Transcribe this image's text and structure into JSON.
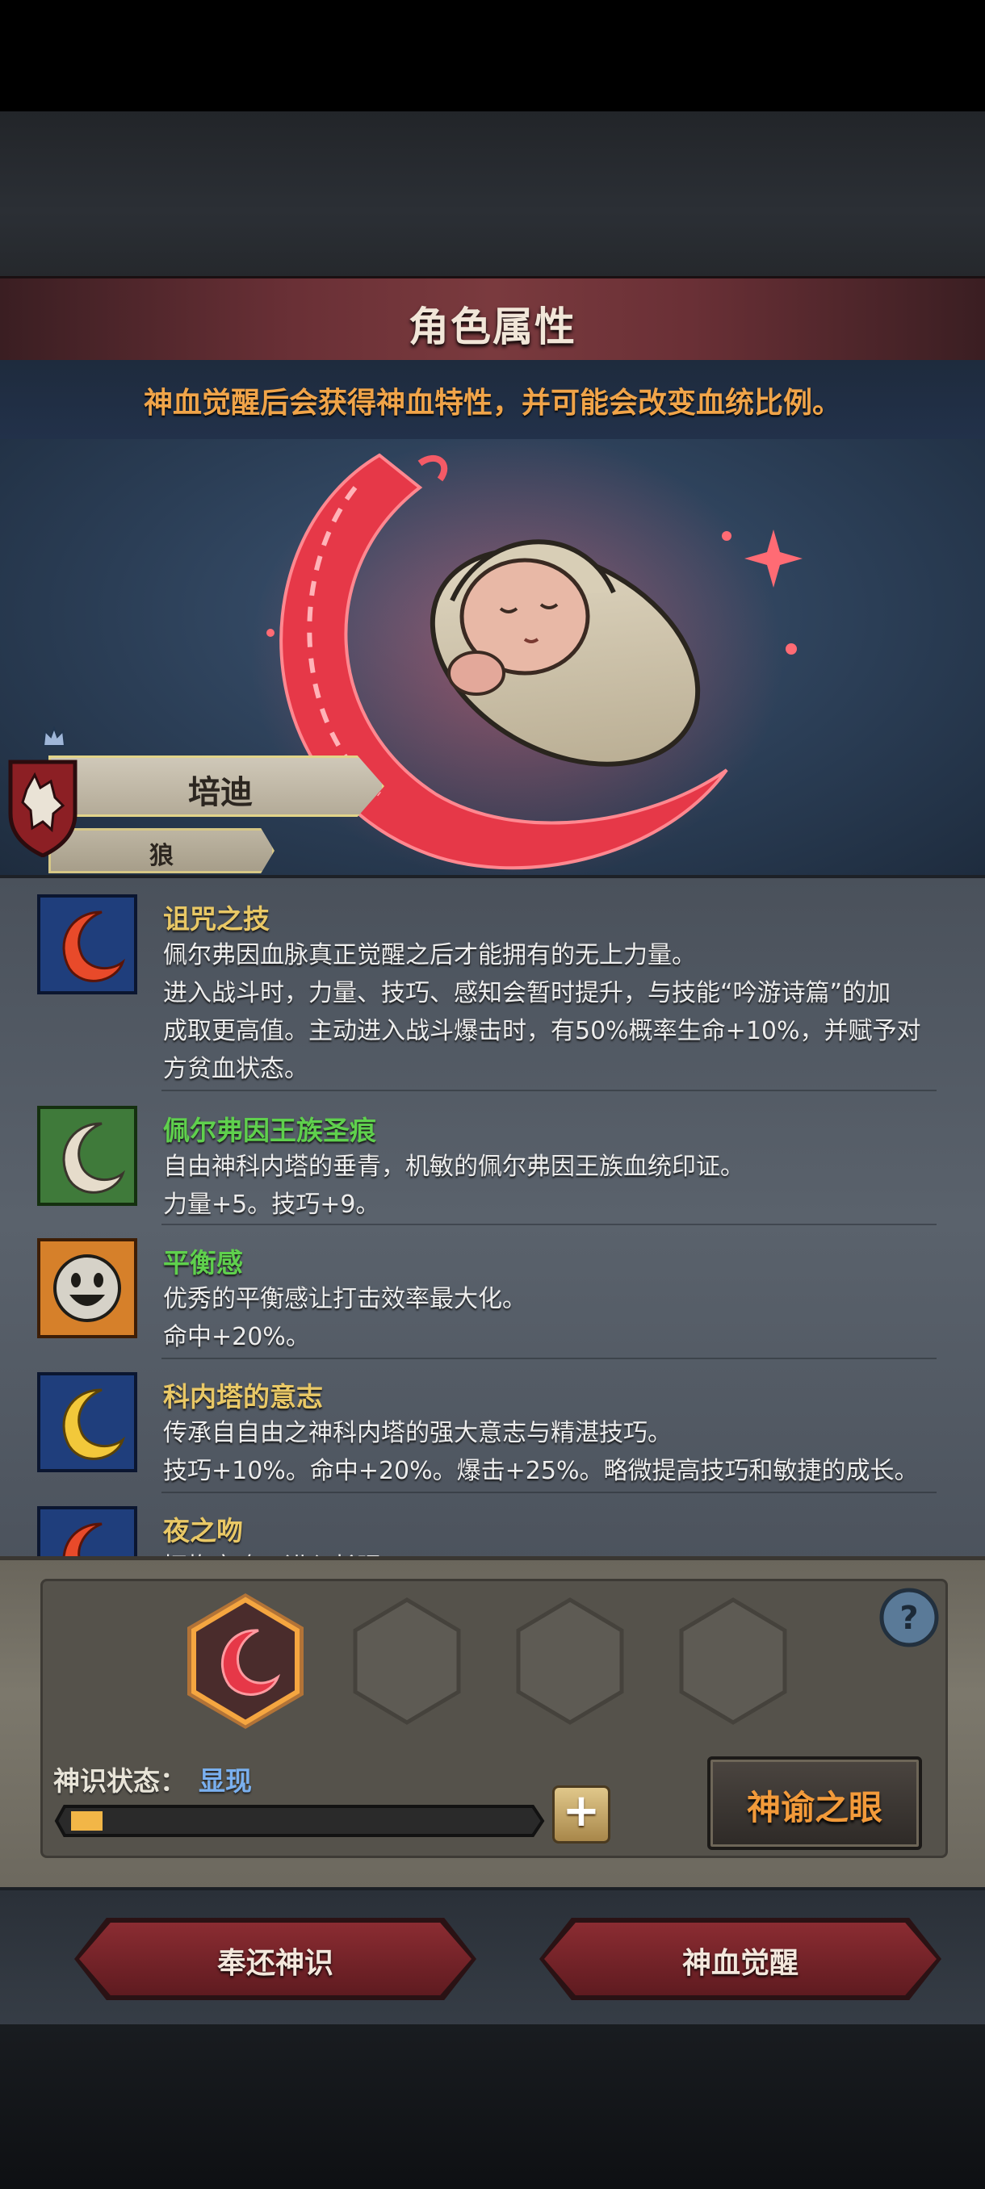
{
  "header": {
    "title": "角色属性",
    "subtitle": "神血觉醒后会获得神血特性，并可能会改变血统比例。"
  },
  "character": {
    "name": "培迪",
    "tag": "狼",
    "emblem": "wolf-shield-icon"
  },
  "traits": [
    {
      "name": "诅咒之技",
      "name_color": "#e9c866",
      "icon": "red-crescent-icon",
      "lines": [
        "佩尔弗因血脉真正觉醒之后才能拥有的无上力量。",
        "进入战斗时，力量、技巧、感知会暂时提升，与技能“吟游诗篇”的加",
        "成取更高值。主动进入战斗爆击时，有50%概率生命+10%，并赋予对",
        "方贫血状态。"
      ]
    },
    {
      "name": "佩尔弗因王族圣痕",
      "name_color": "#5fd04d",
      "icon": "white-crescent-icon",
      "lines": [
        "自由神科内塔的垂青，机敏的佩尔弗因王族血统印证。",
        "力量+5。技巧+9。"
      ]
    },
    {
      "name": "平衡感",
      "name_color": "#5fd04d",
      "icon": "smiley-face-icon",
      "lines": [
        "优秀的平衡感让打击效率最大化。",
        "命中+20%。"
      ]
    },
    {
      "name": "科内塔的意志",
      "name_color": "#e9c866",
      "icon": "gold-crescent-icon",
      "lines": [
        "传承自自由之神科内塔的强大意志与精湛技巧。",
        "技巧+10%。命中+20%。爆击+25%。略微提高技巧和敏捷的成长。"
      ]
    },
    {
      "name": "夜之吻",
      "name_color": "#e9c866",
      "icon": "red-crescent-icon",
      "lines": [
        "拥抱夜晚，进入长眠"
      ]
    }
  ],
  "divine_panel": {
    "state_label": "神识状态：",
    "state_value": "显现",
    "progress": 0.07,
    "oracle_button": "神谕之眼",
    "help": "?",
    "plus": "+",
    "slots": [
      "blood-crescent-slot",
      "empty-slot",
      "empty-slot",
      "empty-slot"
    ]
  },
  "actions": {
    "return_label": "奉还神识",
    "awaken_label": "神血觉醒"
  },
  "colors": {
    "accent_orange": "#f0a449",
    "blood_red": "#e8384a",
    "progress_fill": "#f2b647"
  }
}
